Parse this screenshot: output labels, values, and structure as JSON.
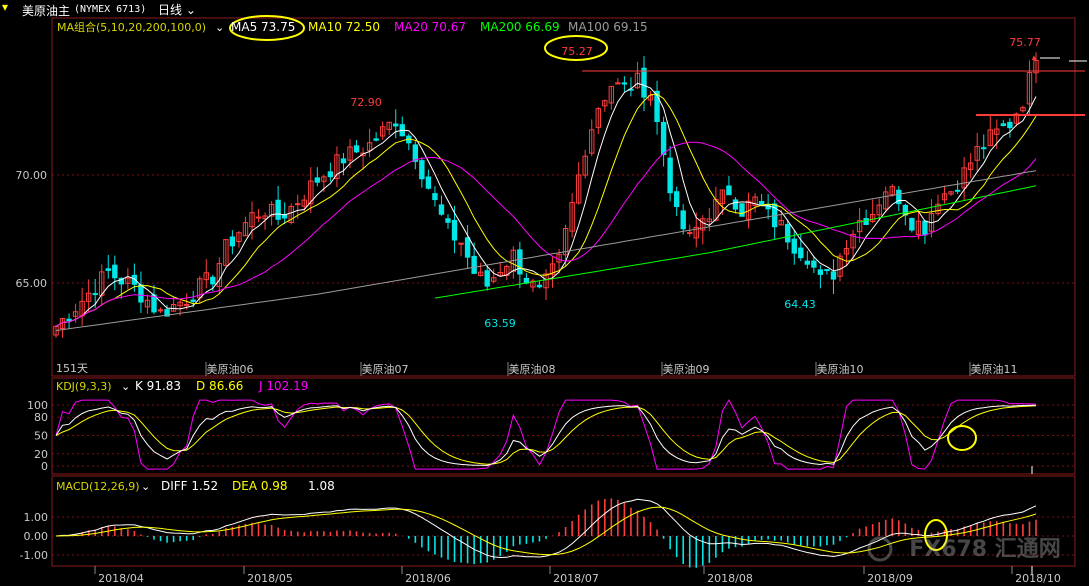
{
  "toolbar": {
    "symbol": "美原油主",
    "code": "(NYMEX 6713)",
    "period": "日线"
  },
  "colors": {
    "bg": "#000000",
    "up": "#ff3c3c",
    "down": "#00e5e5",
    "ma5": "#ffffff",
    "ma10": "#ffff00",
    "ma20": "#ff00ff",
    "ma200": "#00ff00",
    "ma100": "#9a9a9a",
    "highlight": "#ffff00",
    "grid": "#7a1010",
    "axis": "#c8c8c8"
  },
  "panel_price": {
    "indicator": "MA组合(5,10,20,200,100,0)",
    "legend": [
      {
        "label": "MA5",
        "value": "73.75"
      },
      {
        "label": "MA10",
        "value": "72.50"
      },
      {
        "label": "MA20",
        "value": "70.67"
      },
      {
        "label": "MA200",
        "value": "66.69"
      },
      {
        "label": "MA100",
        "value": "69.15"
      }
    ],
    "y_ticks": [
      "70.00",
      "65.00"
    ],
    "annotations": [
      "72.90",
      "75.27",
      "75.77",
      "63.59",
      "64.43"
    ],
    "contract_labels": [
      "美原油06",
      "美原油07",
      "美原油08",
      "美原油09",
      "美原油10",
      "美原油11"
    ],
    "days_label": "151天"
  },
  "panel_kdj": {
    "indicator": "KDJ(9,3,3)",
    "legend": [
      {
        "label": "K",
        "value": "91.83"
      },
      {
        "label": "D",
        "value": "86.66"
      },
      {
        "label": "J",
        "value": "102.19"
      }
    ],
    "y_ticks": [
      "100",
      "80",
      "50",
      "20",
      "0"
    ]
  },
  "panel_macd": {
    "indicator": "MACD(12,26,9)",
    "legend": [
      {
        "label": "DIFF",
        "value": "1.52"
      },
      {
        "label": "DEA",
        "value": "0.98"
      },
      {
        "label": "",
        "value": "1.08"
      }
    ],
    "y_ticks": [
      "1.00",
      "0.00",
      "-1.00"
    ]
  },
  "x_axis": {
    "labels": [
      "2018/04",
      "2018/05",
      "2018/06",
      "2018/07",
      "2018/08",
      "2018/09",
      "2018/10"
    ]
  },
  "watermark": "FX678 汇通网",
  "chart_data": {
    "type": "line",
    "title": "美原油主 (NYMEX 6713) 日线",
    "ylim": [
      62.5,
      76.5
    ],
    "candles_close_path": [
      [
        0,
        63.0
      ],
      [
        4,
        64.2
      ],
      [
        8,
        65.5
      ],
      [
        12,
        64.8
      ],
      [
        16,
        63.6
      ],
      [
        20,
        64.3
      ],
      [
        24,
        65.3
      ],
      [
        26,
        66.6
      ],
      [
        28,
        67.4
      ],
      [
        30,
        68.1
      ],
      [
        32,
        68.4
      ],
      [
        34,
        68.0
      ],
      [
        36,
        68.5
      ],
      [
        40,
        69.8
      ],
      [
        44,
        70.8
      ],
      [
        48,
        71.4
      ],
      [
        52,
        72.6
      ],
      [
        55,
        71.0
      ],
      [
        58,
        68.7
      ],
      [
        60,
        67.4
      ],
      [
        62,
        66.9
      ],
      [
        64,
        65.5
      ],
      [
        66,
        64.9
      ],
      [
        68,
        65.7
      ],
      [
        70,
        66.3
      ],
      [
        72,
        65.2
      ],
      [
        74,
        64.5
      ],
      [
        77,
        66.0
      ],
      [
        79,
        68.6
      ],
      [
        81,
        71.3
      ],
      [
        83,
        73.2
      ],
      [
        85,
        74.2
      ],
      [
        87,
        74.0
      ],
      [
        89,
        74.3
      ],
      [
        91,
        73.8
      ],
      [
        93,
        71.0
      ],
      [
        95,
        68.1
      ],
      [
        97,
        67.0
      ],
      [
        99,
        68.0
      ],
      [
        101,
        68.6
      ],
      [
        103,
        69.3
      ],
      [
        105,
        68.4
      ],
      [
        107,
        68.8
      ],
      [
        109,
        68.1
      ],
      [
        111,
        67.6
      ],
      [
        113,
        66.8
      ],
      [
        115,
        66.3
      ],
      [
        117,
        65.1
      ],
      [
        119,
        65.5
      ],
      [
        121,
        67.0
      ],
      [
        123,
        67.9
      ],
      [
        125,
        68.3
      ],
      [
        127,
        69.4
      ],
      [
        129,
        69.0
      ],
      [
        131,
        67.9
      ],
      [
        133,
        67.6
      ],
      [
        135,
        69.0
      ],
      [
        137,
        69.3
      ],
      [
        139,
        70.1
      ],
      [
        141,
        71.1
      ],
      [
        143,
        71.7
      ],
      [
        146,
        72.4
      ],
      [
        148,
        73.5
      ],
      [
        150,
        75.3
      ]
    ],
    "series": [
      {
        "name": "MA5",
        "value": 73.75
      },
      {
        "name": "MA10",
        "value": 72.5
      },
      {
        "name": "MA20",
        "value": 70.67
      },
      {
        "name": "MA200",
        "value": 66.69
      },
      {
        "name": "MA100",
        "value": 69.15
      }
    ]
  }
}
